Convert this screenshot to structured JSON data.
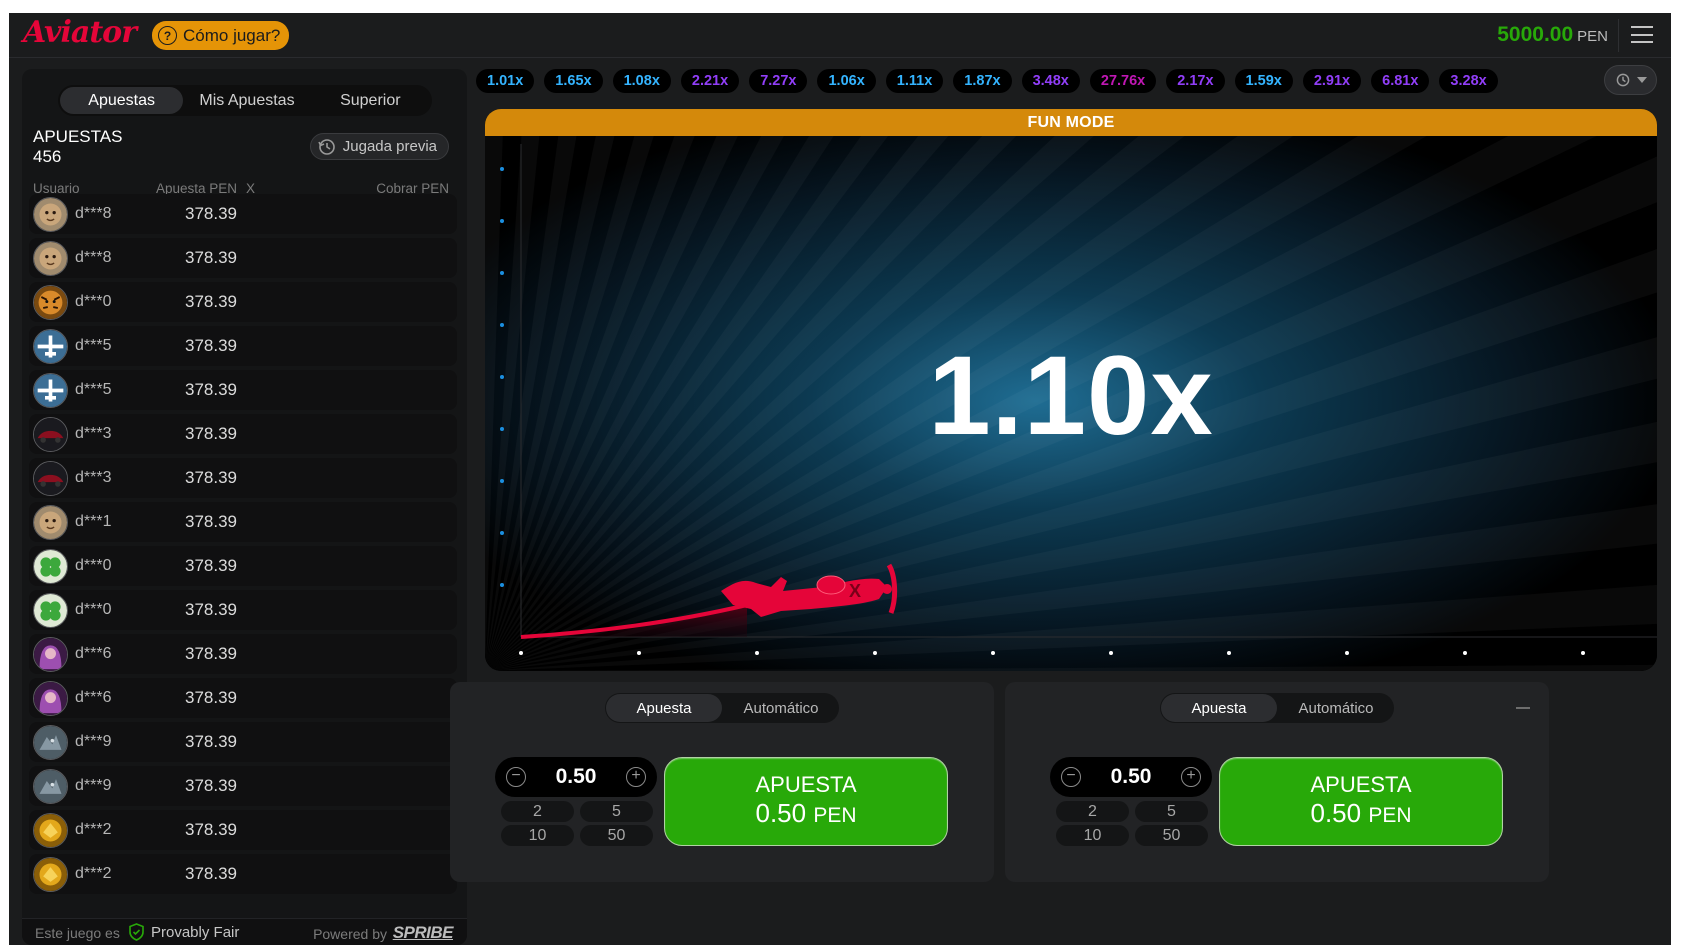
{
  "header": {
    "logo": "Aviator",
    "how_to_play": "Cómo jugar?",
    "how_icon": "?",
    "balance_value": "5000.00",
    "balance_currency": "PEN",
    "menu_icon": "hamburger-menu-icon"
  },
  "sidebar": {
    "tabs": [
      "Apuestas",
      "Mis Apuestas",
      "Superior"
    ],
    "active_tab": "Apuestas",
    "bets_label": "APUESTAS",
    "bets_count": "456",
    "prev_round": "Jugada previa",
    "columns": {
      "user": "Usuario",
      "bet": "Apuesta PEN",
      "x": "X",
      "cashout": "Cobrar PEN"
    },
    "rows": [
      {
        "user": "d***8",
        "amount": "378.39",
        "avatar": "lion-avatar"
      },
      {
        "user": "d***8",
        "amount": "378.39",
        "avatar": "lion-avatar"
      },
      {
        "user": "d***0",
        "amount": "378.39",
        "avatar": "tiger-avatar"
      },
      {
        "user": "d***5",
        "amount": "378.39",
        "avatar": "plane-avatar"
      },
      {
        "user": "d***5",
        "amount": "378.39",
        "avatar": "plane-avatar"
      },
      {
        "user": "d***3",
        "amount": "378.39",
        "avatar": "car-avatar"
      },
      {
        "user": "d***3",
        "amount": "378.39",
        "avatar": "car-avatar"
      },
      {
        "user": "d***1",
        "amount": "378.39",
        "avatar": "lion-avatar"
      },
      {
        "user": "d***0",
        "amount": "378.39",
        "avatar": "clover-avatar"
      },
      {
        "user": "d***0",
        "amount": "378.39",
        "avatar": "clover-avatar"
      },
      {
        "user": "d***6",
        "amount": "378.39",
        "avatar": "girl-avatar"
      },
      {
        "user": "d***6",
        "amount": "378.39",
        "avatar": "girl-avatar"
      },
      {
        "user": "d***9",
        "amount": "378.39",
        "avatar": "dragon-avatar"
      },
      {
        "user": "d***9",
        "amount": "378.39",
        "avatar": "dragon-avatar"
      },
      {
        "user": "d***2",
        "amount": "378.39",
        "avatar": "gold-avatar"
      },
      {
        "user": "d***2",
        "amount": "378.39",
        "avatar": "gold-avatar"
      }
    ],
    "footer": {
      "fair_prefix": "Este juego es",
      "fair_label": "Provably Fair",
      "powered": "Powered by",
      "brand": "SPRIBE"
    }
  },
  "history": [
    {
      "value": "1.01x",
      "color": "#34b4ff"
    },
    {
      "value": "1.65x",
      "color": "#34b4ff"
    },
    {
      "value": "1.08x",
      "color": "#34b4ff"
    },
    {
      "value": "2.21x",
      "color": "#913ef8"
    },
    {
      "value": "7.27x",
      "color": "#913ef8"
    },
    {
      "value": "1.06x",
      "color": "#34b4ff"
    },
    {
      "value": "1.11x",
      "color": "#34b4ff"
    },
    {
      "value": "1.87x",
      "color": "#34b4ff"
    },
    {
      "value": "3.48x",
      "color": "#913ef8"
    },
    {
      "value": "27.76x",
      "color": "#c017b4"
    },
    {
      "value": "2.17x",
      "color": "#913ef8"
    },
    {
      "value": "1.59x",
      "color": "#34b4ff"
    },
    {
      "value": "2.91x",
      "color": "#913ef8"
    },
    {
      "value": "6.81x",
      "color": "#913ef8"
    },
    {
      "value": "3.28x",
      "color": "#913ef8"
    }
  ],
  "game": {
    "mode_banner": "FUN MODE",
    "multiplier": "1.10x",
    "plane_color": "#e50539",
    "axis_dot_color": "#1b8fe0"
  },
  "bet_panels": [
    {
      "tabs": [
        "Apuesta",
        "Automático"
      ],
      "active_tab": "Apuesta",
      "stake": "0.50",
      "quick": [
        "2",
        "5",
        "10",
        "50"
      ],
      "button_label": "APUESTA",
      "button_amount": "0.50",
      "button_currency": "PEN"
    },
    {
      "tabs": [
        "Apuesta",
        "Automático"
      ],
      "active_tab": "Apuesta",
      "stake": "0.50",
      "quick": [
        "2",
        "5",
        "10",
        "50"
      ],
      "button_label": "APUESTA",
      "button_amount": "0.50",
      "button_currency": "PEN"
    }
  ]
}
